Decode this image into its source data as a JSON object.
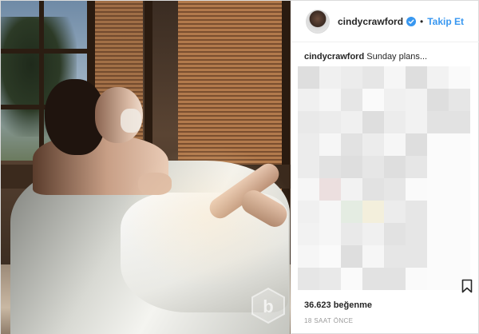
{
  "header": {
    "username": "cindycrawford",
    "follow_label": "Takip Et",
    "separator": "•"
  },
  "caption": {
    "username": "cindycrawford",
    "text": "Sunday plans..."
  },
  "footer": {
    "likes": "36.623 beğenme",
    "time": "18 SAAT ÖNCE"
  },
  "icons": {
    "verified": "verified-badge-icon",
    "bookmark": "bookmark-icon",
    "watermark": "b-logo-watermark"
  },
  "colors": {
    "accent": "#3897f0",
    "text": "#262626",
    "muted": "#999999",
    "border": "#dbdbdb"
  }
}
